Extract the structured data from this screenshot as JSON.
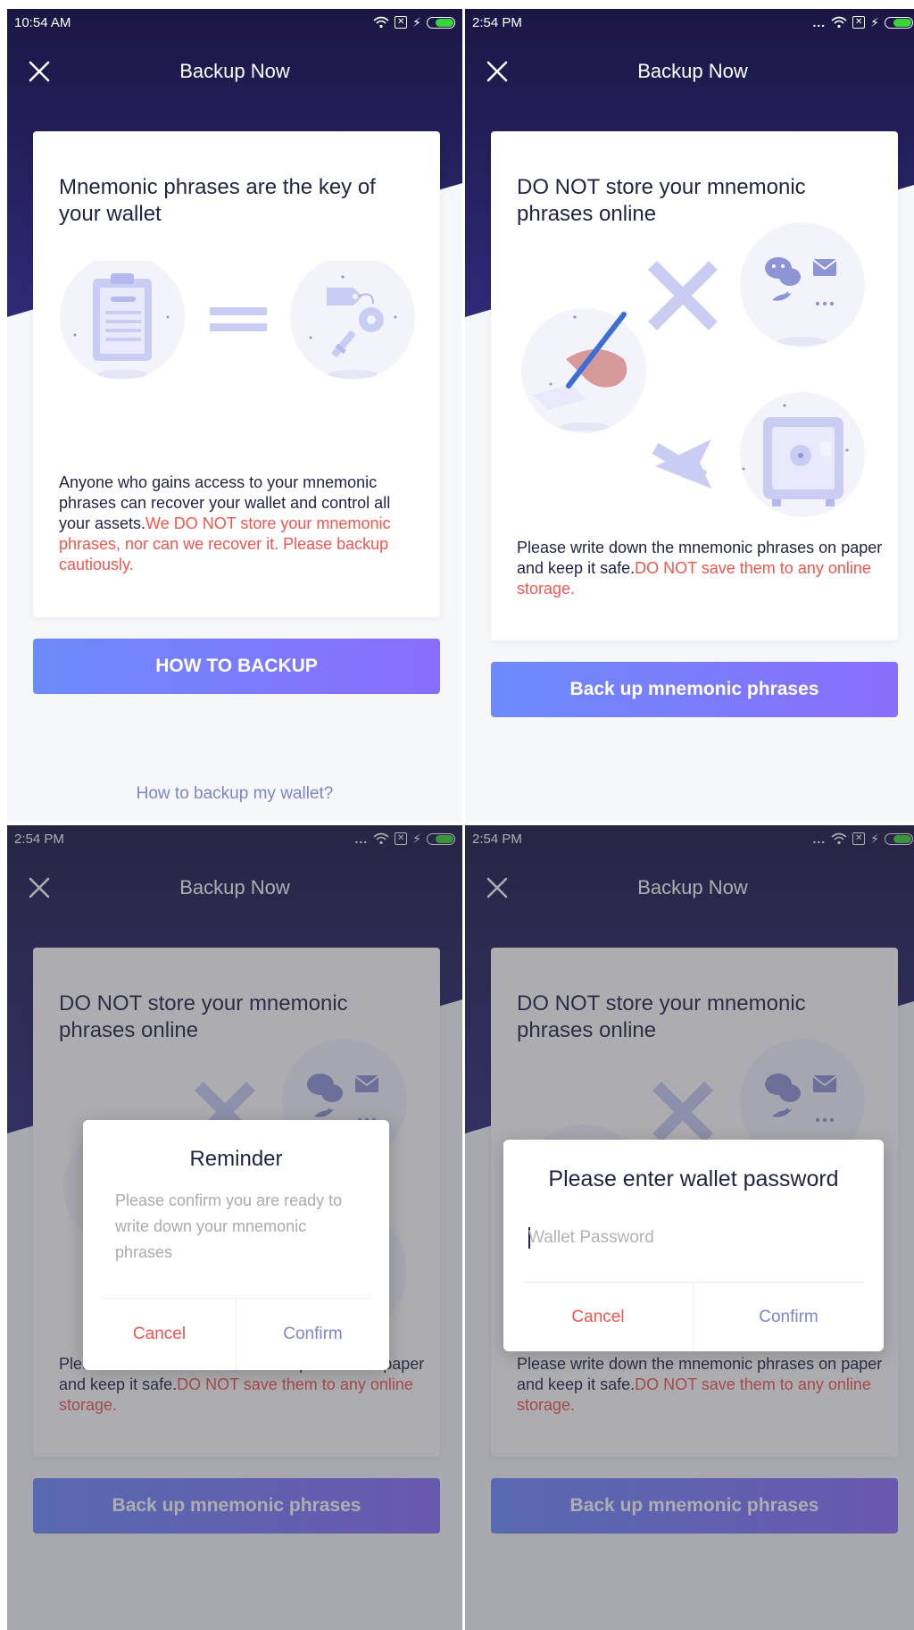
{
  "screens": [
    {
      "status": {
        "time": "10:54 AM"
      },
      "header": {
        "title": "Backup Now"
      },
      "card": {
        "title": "Mnemonic phrases are the key of your wallet",
        "body": "Anyone who gains access to your mnemonic phrases can recover your wallet and control all your assets.",
        "warning": "We DO NOT store your mnemonic phrases, nor can we recover it. Please backup cautiously."
      },
      "primary_button": "HOW TO BACKUP",
      "link": "How to backup my wallet?"
    },
    {
      "status": {
        "time": "2:54 PM"
      },
      "header": {
        "title": "Backup Now"
      },
      "card": {
        "title": "DO NOT store your mnemonic phrases online",
        "body": "Please write down the mnemonic phrases on paper and keep it safe.",
        "warning": "DO NOT save them to any online storage."
      },
      "primary_button": "Back up mnemonic phrases"
    },
    {
      "status": {
        "time": "2:54 PM"
      },
      "header": {
        "title": "Backup Now"
      },
      "card": {
        "title": "DO NOT store your mnemonic phrases online",
        "body": "Please write down the mnemonic phrases on paper and keep it safe.",
        "warning": "DO NOT save them to any online storage."
      },
      "primary_button": "Back up mnemonic phrases",
      "dialog": {
        "title": "Reminder",
        "message": "Please confirm you are ready to write down your mnemonic phrases",
        "cancel": "Cancel",
        "confirm": "Confirm"
      }
    },
    {
      "status": {
        "time": "2:54 PM"
      },
      "header": {
        "title": "Backup Now"
      },
      "card": {
        "title": "DO NOT store your mnemonic phrases online",
        "body": "Please write down the mnemonic phrases on paper and keep it safe.",
        "warning": "DO NOT save them to any online storage."
      },
      "primary_button": "Back up mnemonic phrases",
      "dialog": {
        "title": "Please enter wallet password",
        "input_placeholder": "Wallet Password",
        "input_value": "",
        "cancel": "Cancel",
        "confirm": "Confirm"
      }
    }
  ],
  "colors": {
    "header_dark": "#1a1745",
    "header_mid": "#2e2a78",
    "button_start": "#6c8bfb",
    "button_end": "#8a6dfc",
    "warning": "#f0554f",
    "link": "#7a86c9",
    "illustration": "#b9bfee"
  }
}
